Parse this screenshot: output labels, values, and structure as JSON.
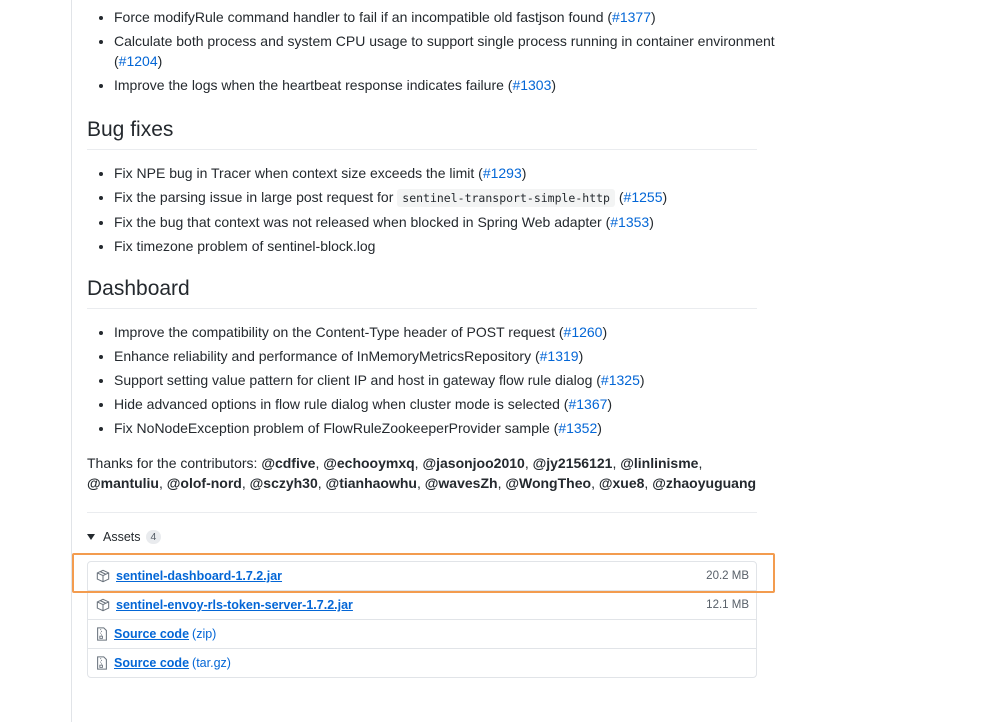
{
  "top_list": [
    {
      "text": "Force modifyRule command handler to fail if an incompatible old fastjson found (",
      "link": "#1377",
      "tail": ")"
    },
    {
      "text": "Calculate both process and system CPU usage to support single process running in container environment (",
      "link": "#1204",
      "tail": ")"
    },
    {
      "text": "Improve the logs when the heartbeat response indicates failure (",
      "link": "#1303",
      "tail": ")"
    }
  ],
  "bug_fixes": {
    "title": "Bug fixes",
    "items": [
      {
        "text": "Fix NPE bug in Tracer when context size exceeds the limit (",
        "link": "#1293",
        "tail": ")"
      },
      {
        "pre": "Fix the parsing issue in large post request for ",
        "code": "sentinel-transport-simple-http",
        "text": " (",
        "link": "#1255",
        "tail": ")"
      },
      {
        "text": "Fix the bug that context was not released when blocked in Spring Web adapter (",
        "link": "#1353",
        "tail": ")"
      },
      {
        "text": "Fix timezone problem of sentinel-block.log"
      }
    ]
  },
  "dashboard": {
    "title": "Dashboard",
    "items": [
      {
        "text": "Improve the compatibility on the Content-Type header of POST request (",
        "link": "#1260",
        "tail": ")"
      },
      {
        "text": "Enhance reliability and performance of InMemoryMetricsRepository (",
        "link": "#1319",
        "tail": ")"
      },
      {
        "text": "Support setting value pattern for client IP and host in gateway flow rule dialog (",
        "link": "#1325",
        "tail": ")"
      },
      {
        "text": "Hide advanced options in flow rule dialog when cluster mode is selected (",
        "link": "#1367",
        "tail": ")"
      },
      {
        "text": "Fix NoNodeException problem of FlowRuleZookeeperProvider sample (",
        "link": "#1352",
        "tail": ")"
      }
    ]
  },
  "thanks": {
    "prefix": "Thanks for the contributors: ",
    "contributors": [
      "@cdfive",
      "@echooymxq",
      "@jasonjoo2010",
      "@jy2156121",
      "@linlinisme",
      "@mantuliu",
      "@olof-nord",
      "@sczyh30",
      "@tianhaowhu",
      "@wavesZh",
      "@WongTheo",
      "@xue8",
      "@zhaoyuguang"
    ]
  },
  "assets": {
    "label": "Assets",
    "count": "4",
    "files": [
      {
        "name": "sentinel-dashboard-1.7.2.jar",
        "size": "20.2 MB",
        "icon": "package-icon"
      },
      {
        "name": "sentinel-envoy-rls-token-server-1.7.2.jar",
        "size": "12.1 MB",
        "icon": "package-icon"
      }
    ],
    "sources": [
      {
        "name": "Source code",
        "type": "(zip)",
        "icon": "file-zip-icon"
      },
      {
        "name": "Source code",
        "type": "(tar.gz)",
        "icon": "file-zip-icon"
      }
    ]
  },
  "colors": {
    "link": "#0366d6",
    "highlight": "#f39c4f"
  }
}
